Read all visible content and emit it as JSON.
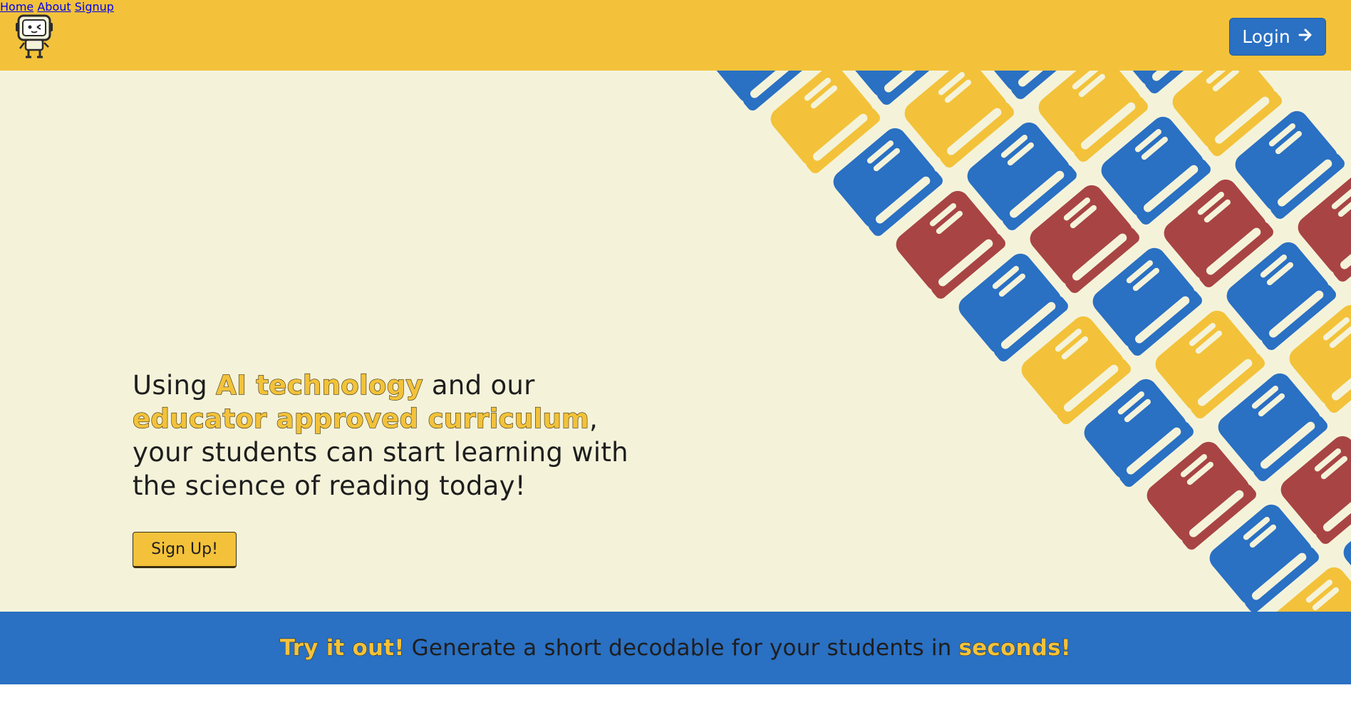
{
  "header": {
    "logo_icon": "robot-mascot-icon",
    "nav": {
      "home": "Home",
      "about": "About",
      "signup": "Signup"
    },
    "login_label": "Login",
    "login_icon": "arrow-right-icon"
  },
  "hero": {
    "text_part1": "Using ",
    "highlight1": "AI technology",
    "text_part2": " and our ",
    "highlight2": "educator approved curriculum",
    "text_part3": ", your students can start learning with the science of reading today!",
    "signup_button": "Sign Up!",
    "pattern_icon": "book-icon"
  },
  "banner": {
    "highlight_start": "Try it out!",
    "text": "Generate a short decodable for your students in",
    "highlight_end": "seconds!"
  },
  "colors": {
    "header_bg": "#f3c23a",
    "hero_bg": "#f4f3da",
    "accent_blue": "#2a70c3",
    "book_red": "#a84444",
    "book_yellow": "#f3c23a",
    "book_blue": "#2a70c3"
  }
}
